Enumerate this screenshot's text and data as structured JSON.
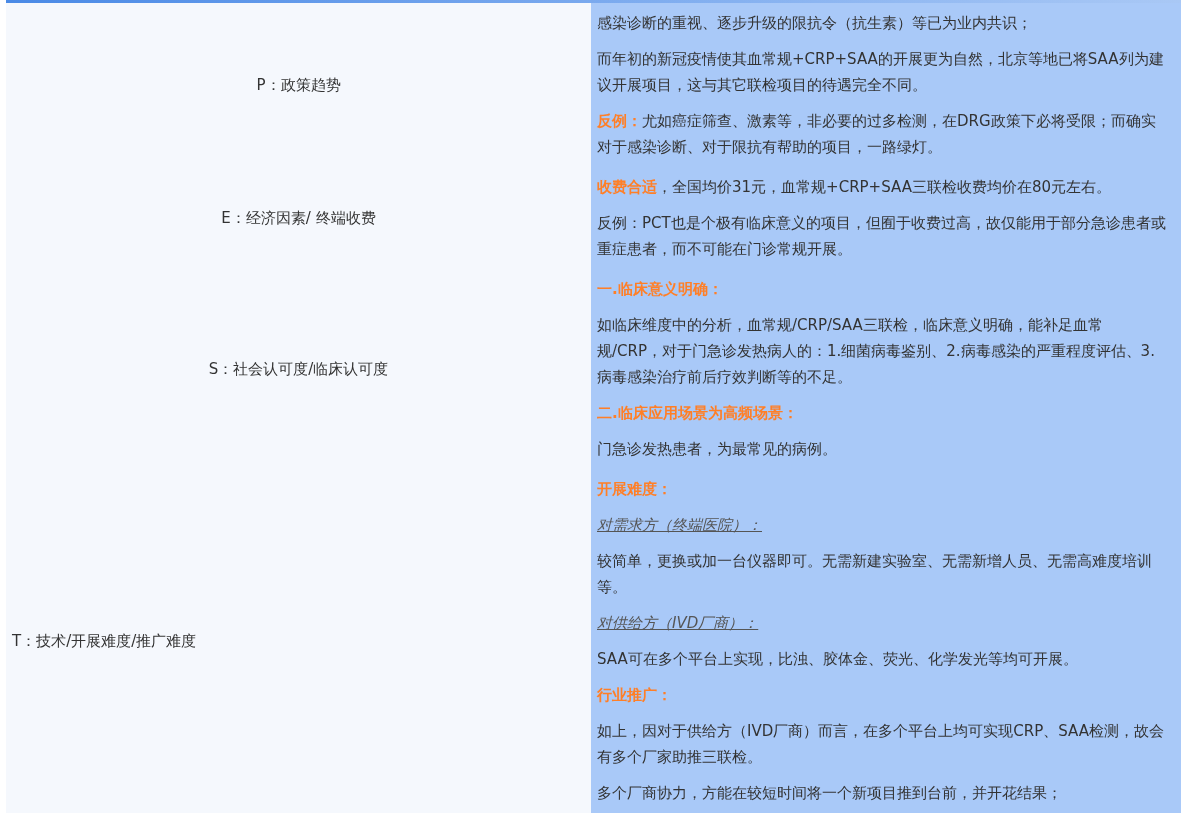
{
  "rows": [
    {
      "label": "P：政策趋势",
      "paragraphs": [
        {
          "kind": "text",
          "text": "感染诊断的重视、逐步升级的限抗令（抗生素）等已为业内共识；"
        },
        {
          "kind": "text",
          "text": "而年初的新冠疫情使其血常规+CRP+SAA的开展更为自然，北京等地已将SAA列为建议开展项目，这与其它联检项目的待遇完全不同。"
        },
        {
          "kind": "text",
          "text": "**反例：**尤如癌症筛查、激素等，非必要的过多检测，在DRG政策下必将受限；而确实对于感染诊断、对于限抗有帮助的项目，一路绿灯。"
        }
      ]
    },
    {
      "label": "E：经济因素/ 终端收费",
      "paragraphs": [
        {
          "kind": "text",
          "text": "**收费合适**，全国均价31元，血常规+CRP+SAA三联检收费均价在80元左右。"
        },
        {
          "kind": "text",
          "text": "反例：PCT也是个极有临床意义的项目，但囿于收费过高，故仅能用于部分急诊患者或重症患者，而不可能在门诊常规开展。"
        }
      ]
    },
    {
      "label": "S：社会认可度/临床认可度",
      "paragraphs": [
        {
          "kind": "heading",
          "text": "一.临床意义明确："
        },
        {
          "kind": "text",
          "text": "如临床维度中的分析，血常规/CRP/SAA三联检，临床意义明确，能补足血常规/CRP，对于门急诊发热病人的：1.细菌病毒鉴别、2.病毒感染的严重程度评估、3.病毒感染治疗前后疗效判断等的不足。"
        },
        {
          "kind": "heading",
          "text": "二.临床应用场景为高频场景："
        },
        {
          "kind": "text",
          "text": "门急诊发热患者，为最常见的病例。"
        }
      ]
    },
    {
      "label": "T：技术/开展难度/推广难度",
      "paragraphs": [
        {
          "kind": "heading",
          "text": "开展难度："
        },
        {
          "kind": "subheading",
          "text": "对需求方（终端医院）："
        },
        {
          "kind": "text",
          "text": "较简单，更换或加一台仪器即可。无需新建实验室、无需新增人员、无需高难度培训等。"
        },
        {
          "kind": "subheading",
          "text": "对供给方（IVD厂商）："
        },
        {
          "kind": "text",
          "text": "SAA可在多个平台上实现，比浊、胶体金、荧光、化学发光等均可开展。"
        },
        {
          "kind": "heading",
          "text": "行业推广："
        },
        {
          "kind": "text",
          "text": "如上，因对于供给方（IVD厂商）而言，在多个平台上均可实现CRP、SAA检测，故会有多个厂家助推三联检。"
        },
        {
          "kind": "text",
          "text": "多个厂商协力，方能在较短时间将一个新项目推到台前，并开花结果；"
        }
      ]
    }
  ]
}
